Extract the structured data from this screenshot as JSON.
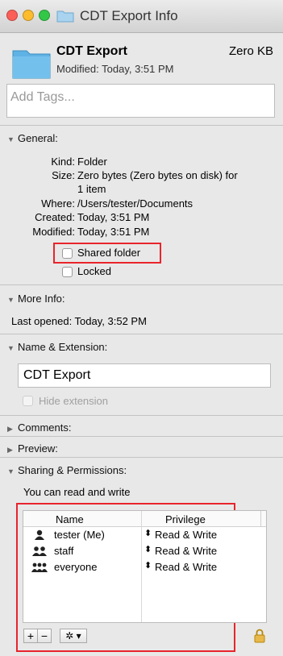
{
  "window": {
    "title": "CDT Export Info"
  },
  "file": {
    "name": "CDT Export",
    "size": "Zero KB",
    "modified": "Modified: Today, 3:51 PM"
  },
  "tags": {
    "placeholder": "Add Tags..."
  },
  "general": {
    "header": "General:",
    "rows": [
      {
        "label": "Kind:",
        "value": "Folder"
      },
      {
        "label": "Size:",
        "value": "Zero bytes (Zero bytes on disk) for"
      },
      {
        "label": "",
        "value": "1 item"
      },
      {
        "label": "Where:",
        "value": "/Users/tester/Documents"
      },
      {
        "label": "Created:",
        "value": "Today, 3:51 PM"
      },
      {
        "label": "Modified:",
        "value": "Today, 3:51 PM"
      }
    ],
    "shared_folder": "Shared folder",
    "locked": "Locked"
  },
  "more_info": {
    "header": "More Info:",
    "last_opened": "Last opened: Today, 3:52 PM"
  },
  "name_extension": {
    "header": "Name & Extension:",
    "value": "CDT Export",
    "hide_extension": "Hide extension"
  },
  "comments": {
    "header": "Comments:"
  },
  "preview": {
    "header": "Preview:"
  },
  "sharing": {
    "header": "Sharing & Permissions:",
    "summary": "You can read and write",
    "col_name": "Name",
    "col_privilege": "Privilege",
    "rows": [
      {
        "name": "tester (Me)",
        "privilege": "Read & Write",
        "icon": "person-icon"
      },
      {
        "name": "staff",
        "privilege": "Read & Write",
        "icon": "group-icon"
      },
      {
        "name": "everyone",
        "privilege": "Read & Write",
        "icon": "everyone-icon"
      }
    ],
    "add": "+",
    "remove": "−",
    "action": "✲ ▾"
  },
  "colors": {
    "highlight": "#e8242c",
    "folder": "#67b8e8"
  }
}
